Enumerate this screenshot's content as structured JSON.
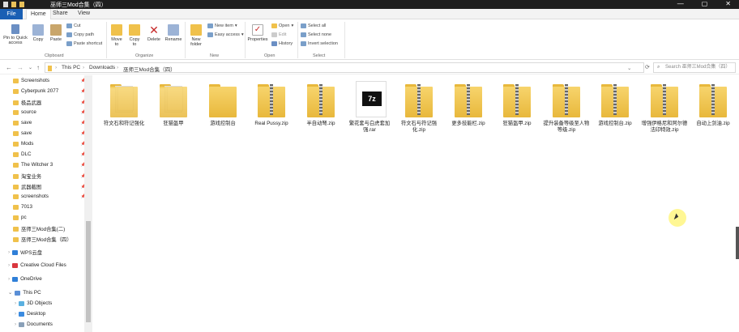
{
  "window": {
    "title": "巫师三Mod合集（四）",
    "controls": [
      "—",
      "▢",
      "✕"
    ]
  },
  "ribbon_tabs": [
    "File",
    "Home",
    "Share",
    "View"
  ],
  "ribbon": {
    "clipboard": {
      "pin": "Pin to Quick access",
      "copy": "Copy",
      "paste": "Paste",
      "cut": "Cut",
      "copy_path": "Copy path",
      "paste_shortcut": "Paste shortcut",
      "group": "Clipboard"
    },
    "organize": {
      "move_to": "Move to",
      "copy_to": "Copy to",
      "delete": "Delete",
      "rename": "Rename",
      "group": "Organize"
    },
    "new": {
      "new_folder": "New folder",
      "new_item": "New item",
      "easy_access": "Easy access",
      "group": "New"
    },
    "open": {
      "properties": "Properties",
      "open": "Open",
      "edit": "Edit",
      "history": "History",
      "group": "Open"
    },
    "select": {
      "select_all": "Select all",
      "select_none": "Select none",
      "invert": "Invert selection",
      "group": "Select"
    }
  },
  "address": {
    "crumbs": [
      "This PC",
      "Downloads",
      "巫师三Mod合集（四）"
    ],
    "search_placeholder": "Search 巫师三Mod合集（四）"
  },
  "sidebar": {
    "quick_access": [
      "Screenshots",
      "Cyberpunk 2077",
      "极品武器",
      "source",
      "save",
      "save",
      "Mods",
      "DLC",
      "The Witcher 3",
      "淘宝业务",
      "武器截图",
      "screenshots",
      "7013",
      "pc",
      "巫师三Mod合集(二)",
      "巫师三Mod合集（四）"
    ],
    "pinned_count": 12,
    "locations": [
      "WPS云盘",
      "Creative Cloud Files",
      "OneDrive",
      "This PC"
    ],
    "this_pc_children": [
      "3D Objects",
      "Desktop",
      "Documents"
    ]
  },
  "files": [
    {
      "name": "符文石和符记强化",
      "type": "folder-doc"
    },
    {
      "name": "狂猫盔甲",
      "type": "folder-doc"
    },
    {
      "name": "游戏控制台",
      "type": "folder"
    },
    {
      "name": "Real Pussy.zip",
      "type": "zip"
    },
    {
      "name": "半自动弩.zip",
      "type": "zip"
    },
    {
      "name": "繁花套与白虎套加强.rar",
      "type": "7z",
      "logo": "7z"
    },
    {
      "name": "符文石与符记强化.zip",
      "type": "zip"
    },
    {
      "name": "更多技能栏.zip",
      "type": "zip"
    },
    {
      "name": "狂猫盔甲.zip",
      "type": "zip"
    },
    {
      "name": "提升装备等级至人物等级.zip",
      "type": "zip"
    },
    {
      "name": "游戏控制台.zip",
      "type": "zip"
    },
    {
      "name": "增强伊格尼和阿尔德法印特效.zip",
      "type": "zip"
    },
    {
      "name": "自动上剑油.zip",
      "type": "zip"
    }
  ],
  "colors": {
    "accent": "#1a5fb4",
    "folder": "#f0c14b",
    "cursor_highlight": "#fff03c"
  }
}
